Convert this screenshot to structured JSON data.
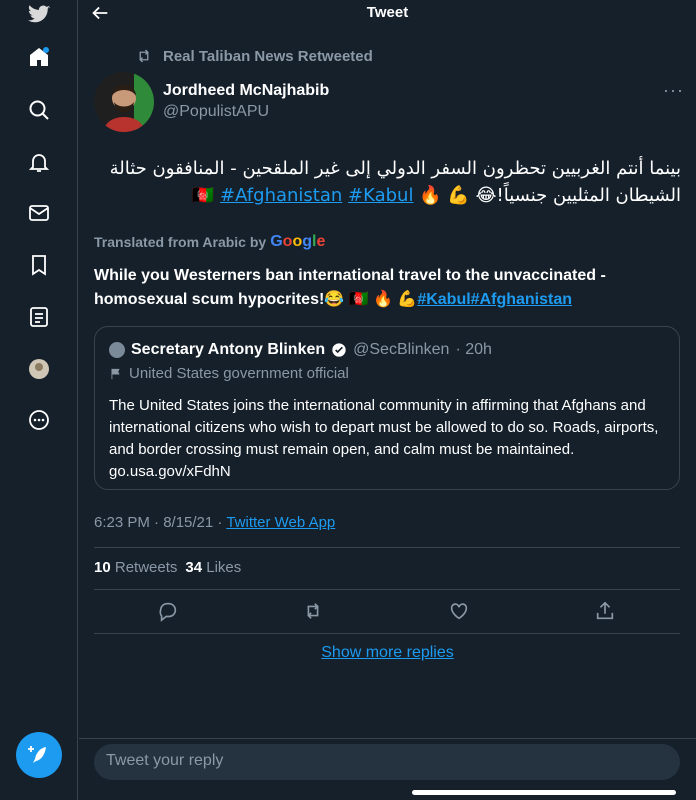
{
  "header": {
    "title": "Tweet"
  },
  "retweet": {
    "label": "Real Taliban News Retweeted"
  },
  "author": {
    "name": "Jordheed McNajhabib",
    "handle": "@PopulistAPU",
    "more": "···"
  },
  "tweet": {
    "arabic_text": "بينما أنتم الغربيين تحظرون السفر الدولي إلى غير الملقحين - المنافقون حثالة الشيطان المثليين جنسياً!😂",
    "arabic_tags": [
      "#Afghanistan",
      "#Kabul"
    ],
    "arabic_emojis": "💪 🔥 🇦🇫",
    "translated_label": "Translated from Arabic by",
    "translator": "Google",
    "translation": "While you Westerners ban international travel to the unvaccinated - homosexual scum hypocrites!😂 🇦🇫 🔥 💪",
    "translation_tags": "#Kabul#Afghanistan"
  },
  "quote": {
    "name": "Secretary Antony Blinken",
    "handle": "@SecBlinken",
    "time": "· 20h",
    "label": "United States government official",
    "text": "The United States joins the international community in affirming that Afghans and international citizens who wish to depart must be allowed to do so. Roads, airports, and border crossing must remain open, and calm must be maintained. go.usa.gov/xFdhN"
  },
  "meta": {
    "time": "6:23 PM · 8/15/21 · ",
    "app": "Twitter Web App"
  },
  "stats": {
    "retweets": "10",
    "retweets_label": "Retweets",
    "likes": "34",
    "likes_label": "Likes"
  },
  "show_more": "Show more replies",
  "reply": {
    "placeholder": "Tweet your reply"
  },
  "colors": {
    "background": "#15202b",
    "accent": "#1d9bf0",
    "muted": "#8b98a5",
    "border": "#38444d"
  }
}
